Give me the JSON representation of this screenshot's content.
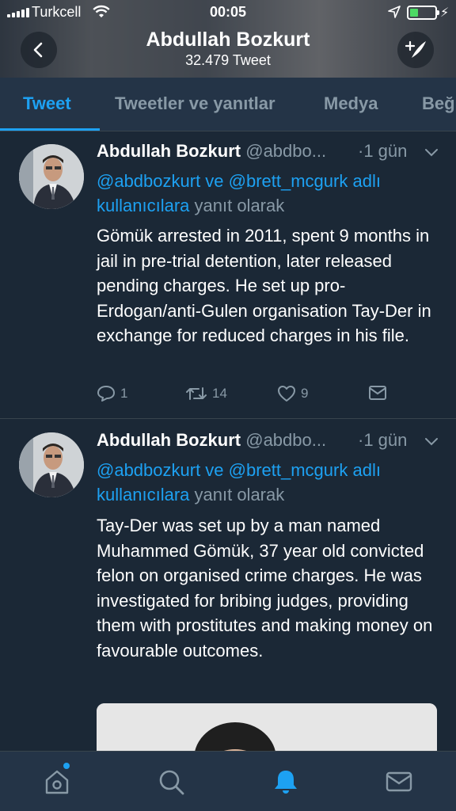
{
  "status_bar": {
    "carrier": "Turkcell",
    "time": "00:05"
  },
  "header": {
    "title": "Abdullah Bozkurt",
    "subtitle": "32.479 Tweet"
  },
  "tabs": [
    {
      "label": "Tweet",
      "active": true
    },
    {
      "label": "Tweetler ve yanıtlar",
      "active": false
    },
    {
      "label": "Medya",
      "active": false
    },
    {
      "label": "Beğ",
      "active": false
    }
  ],
  "tweets": [
    {
      "name": "Abdullah Bozkurt",
      "handle": "@abdbo...",
      "time": "·1 gün",
      "reply_mentions": "@abdbozkurt ve @brett_mcgurk adlı kullanıcılara",
      "reply_suffix": "yanıt olarak",
      "text": "Gömük arrested in 2011, spent 9 months in jail in pre-trial detention, later released pending charges. He set up pro-Erdogan/anti-Gulen organisation Tay-Der in exchange for reduced charges in his file.",
      "replies": "1",
      "retweets": "14",
      "likes": "9"
    },
    {
      "name": "Abdullah Bozkurt",
      "handle": "@abdbo...",
      "time": "·1 gün",
      "reply_mentions": "@abdbozkurt ve @brett_mcgurk adlı kullanıcılara",
      "reply_suffix": "yanıt olarak",
      "text": "Tay-Der was set up by a man named Muhammed Gömük, 37 year old convicted felon on organised crime charges. He was investigated for bribing judges, providing them with prostitutes and making money on favourable outcomes."
    }
  ],
  "colors": {
    "accent": "#1da1f2",
    "background": "#1b2836",
    "muted": "#8899a6"
  },
  "icons": [
    "back-arrow-icon",
    "compose-tweet-icon",
    "chevron-down-icon",
    "reply-icon",
    "retweet-icon",
    "like-icon",
    "share-mail-icon",
    "home-icon",
    "search-icon",
    "notifications-bell-icon",
    "messages-mail-icon"
  ]
}
